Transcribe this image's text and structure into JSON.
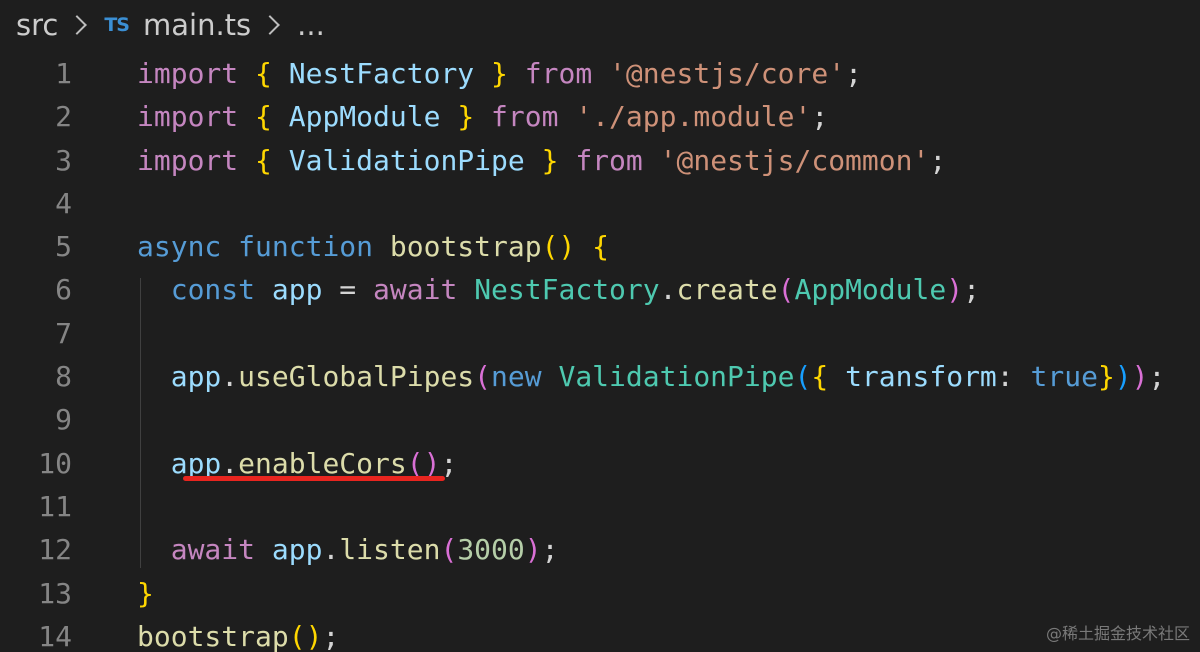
{
  "breadcrumb": {
    "folder": "src",
    "file_icon": "TS",
    "file": "main.ts",
    "more": "..."
  },
  "colors": {
    "background": "#1e1e1e",
    "keyword_control": "#c586c0",
    "keyword": "#569cd6",
    "variable": "#9cdcfe",
    "type": "#4ec9b0",
    "function": "#dcdcaa",
    "string": "#ce9178",
    "number": "#b5cea8",
    "bracket_level_1": "#ffd700",
    "bracket_level_2": "#da70d6",
    "bracket_level_3": "#179fff",
    "annotation_underline": "#e8251f"
  },
  "lines": [
    {
      "n": "1",
      "tokens": [
        [
          "import",
          "kw-import"
        ],
        [
          " "
        ],
        [
          "{",
          "brace"
        ],
        [
          " "
        ],
        [
          "NestFactory",
          "var"
        ],
        [
          " "
        ],
        [
          "}",
          "brace"
        ],
        [
          " "
        ],
        [
          "from",
          "kw-import"
        ],
        [
          " "
        ],
        [
          "'@nestjs/core'",
          "str"
        ],
        [
          ";",
          "punc"
        ]
      ]
    },
    {
      "n": "2",
      "tokens": [
        [
          "import",
          "kw-import"
        ],
        [
          " "
        ],
        [
          "{",
          "brace"
        ],
        [
          " "
        ],
        [
          "AppModule",
          "var"
        ],
        [
          " "
        ],
        [
          "}",
          "brace"
        ],
        [
          " "
        ],
        [
          "from",
          "kw-import"
        ],
        [
          " "
        ],
        [
          "'./app.module'",
          "str"
        ],
        [
          ";",
          "punc"
        ]
      ]
    },
    {
      "n": "3",
      "tokens": [
        [
          "import",
          "kw-import"
        ],
        [
          " "
        ],
        [
          "{",
          "brace"
        ],
        [
          " "
        ],
        [
          "ValidationPipe",
          "var"
        ],
        [
          " "
        ],
        [
          "}",
          "brace"
        ],
        [
          " "
        ],
        [
          "from",
          "kw-import"
        ],
        [
          " "
        ],
        [
          "'@nestjs/common'",
          "str"
        ],
        [
          ";",
          "punc"
        ]
      ]
    },
    {
      "n": "4",
      "tokens": []
    },
    {
      "n": "5",
      "tokens": [
        [
          "async",
          "kw-blue"
        ],
        [
          " "
        ],
        [
          "function",
          "kw-blue"
        ],
        [
          " "
        ],
        [
          "bootstrap",
          "fn"
        ],
        [
          "()",
          "brace"
        ],
        [
          " "
        ],
        [
          "{",
          "brace"
        ]
      ]
    },
    {
      "n": "6",
      "tokens": [
        [
          "  "
        ],
        [
          "const",
          "kw-blue"
        ],
        [
          " "
        ],
        [
          "app",
          "var"
        ],
        [
          " = ",
          "punc"
        ],
        [
          "await",
          "kw-import"
        ],
        [
          " "
        ],
        [
          "NestFactory",
          "type"
        ],
        [
          ".",
          "punc"
        ],
        [
          "create",
          "fn"
        ],
        [
          "(",
          "brace2"
        ],
        [
          "AppModule",
          "type"
        ],
        [
          ")",
          "brace2"
        ],
        [
          ";",
          "punc"
        ]
      ]
    },
    {
      "n": "7",
      "tokens": []
    },
    {
      "n": "8",
      "tokens": [
        [
          "  "
        ],
        [
          "app",
          "var"
        ],
        [
          ".",
          "punc"
        ],
        [
          "useGlobalPipes",
          "fn"
        ],
        [
          "(",
          "brace2"
        ],
        [
          "new",
          "kw-blue"
        ],
        [
          " "
        ],
        [
          "ValidationPipe",
          "type"
        ],
        [
          "(",
          "brace3"
        ],
        [
          "{",
          "brace"
        ],
        [
          " "
        ],
        [
          "transform",
          "var"
        ],
        [
          ": ",
          "punc"
        ],
        [
          "true",
          "kw-blue"
        ],
        [
          "}",
          "brace"
        ],
        [
          ")",
          "brace3"
        ],
        [
          ")",
          "brace2"
        ],
        [
          ";",
          "punc"
        ]
      ]
    },
    {
      "n": "9",
      "tokens": []
    },
    {
      "n": "10",
      "tokens": [
        [
          "  "
        ],
        [
          "app",
          "var"
        ],
        [
          ".",
          "punc"
        ],
        [
          "enableCors",
          "fn"
        ],
        [
          "()",
          "brace2"
        ],
        [
          ";",
          "punc"
        ]
      ]
    },
    {
      "n": "11",
      "tokens": []
    },
    {
      "n": "12",
      "tokens": [
        [
          "  "
        ],
        [
          "await",
          "kw-import"
        ],
        [
          " "
        ],
        [
          "app",
          "var"
        ],
        [
          ".",
          "punc"
        ],
        [
          "listen",
          "fn"
        ],
        [
          "(",
          "brace2"
        ],
        [
          "3000",
          "num"
        ],
        [
          ")",
          "brace2"
        ],
        [
          ";",
          "punc"
        ]
      ]
    },
    {
      "n": "13",
      "tokens": [
        [
          "}",
          "brace"
        ]
      ]
    },
    {
      "n": "14",
      "tokens": [
        [
          "bootstrap",
          "fn"
        ],
        [
          "()",
          "brace"
        ],
        [
          ";",
          "punc"
        ]
      ]
    }
  ],
  "watermark": "@稀土掘金技术社区"
}
